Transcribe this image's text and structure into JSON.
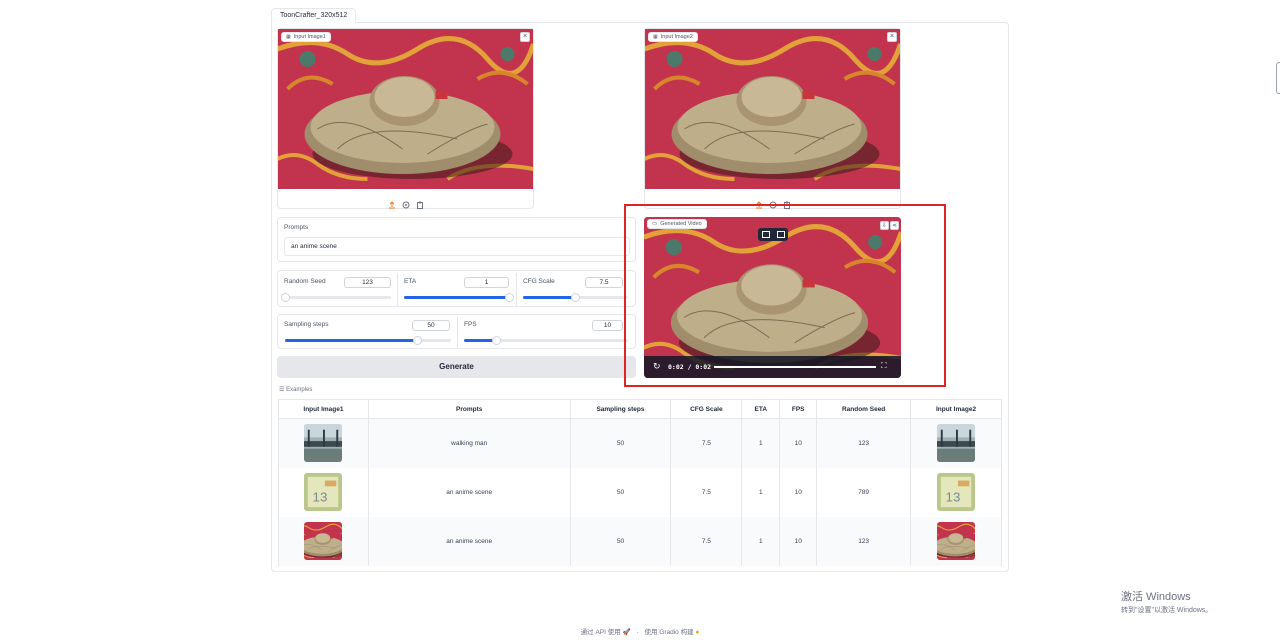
{
  "app": {
    "tab_label": "ToonCrafter_320x512"
  },
  "input_image1": {
    "label": "Input Image1",
    "close": "×"
  },
  "input_image2": {
    "label": "Input Image2",
    "close": "×"
  },
  "prompts": {
    "label": "Prompts",
    "value": "an anime scene"
  },
  "random_seed": {
    "label": "Random Seed",
    "value": "123",
    "level": 0.0
  },
  "eta": {
    "label": "ETA",
    "value": "1",
    "level": 1.0
  },
  "cfg_scale": {
    "label": "CFG Scale",
    "value": "7.5",
    "level": 0.5
  },
  "sampling_steps": {
    "label": "Sampling steps",
    "value": "50",
    "level": 0.8
  },
  "fps": {
    "label": "FPS",
    "value": "10",
    "level": 0.2
  },
  "generate": {
    "label": "Generate"
  },
  "video": {
    "label": "Generated Video",
    "time": "0:02 / 0:02",
    "progress": 1.0
  },
  "examples": {
    "label": "Examples",
    "headers": [
      "Input Image1",
      "Prompts",
      "Sampling steps",
      "CFG Scale",
      "ETA",
      "FPS",
      "Random Seed",
      "Input Image2"
    ],
    "rows": [
      {
        "prompt": "walking man",
        "steps": "50",
        "cfg": "7.5",
        "eta": "1",
        "fps": "10",
        "seed": "123",
        "thumb": "train-station"
      },
      {
        "prompt": "an anime scene",
        "steps": "50",
        "cfg": "7.5",
        "eta": "1",
        "fps": "10",
        "seed": "789",
        "thumb": "paper-13"
      },
      {
        "prompt": "an anime scene",
        "steps": "50",
        "cfg": "7.5",
        "eta": "1",
        "fps": "10",
        "seed": "123",
        "thumb": "cushion-on-rug"
      }
    ]
  },
  "footer": {
    "api": "通过 API 使用",
    "sep": "·",
    "built": "使用 Gradio 构建"
  },
  "windows": {
    "line1": "激活 Windows",
    "line2": "转到\"设置\"以激活 Windows。"
  },
  "colors": {
    "accent": "#2563eb",
    "highlight": "#dc2626",
    "rug": "#c2344d",
    "cushion": "#b6a27f"
  }
}
